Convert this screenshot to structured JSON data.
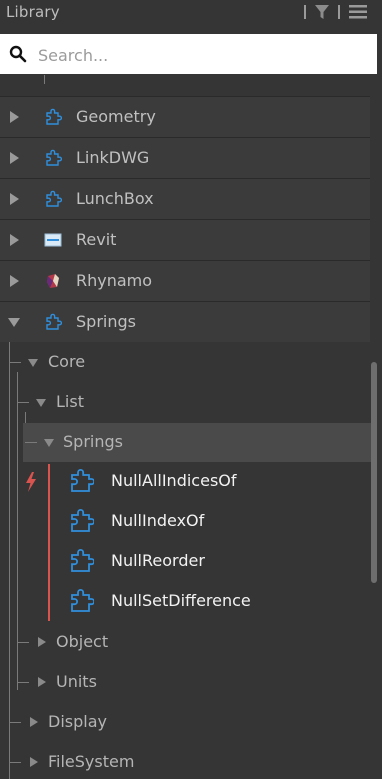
{
  "header": {
    "title": "Library",
    "icons": [
      "filter-icon",
      "list-view-icon"
    ]
  },
  "search": {
    "placeholder": "Search...",
    "value": ""
  },
  "categories": [
    {
      "label": "Geometry",
      "icon": "package-icon",
      "expanded": false
    },
    {
      "label": "LinkDWG",
      "icon": "package-icon",
      "expanded": false
    },
    {
      "label": "LunchBox",
      "icon": "package-icon",
      "expanded": false
    },
    {
      "label": "Revit",
      "icon": "revit-icon",
      "expanded": false
    },
    {
      "label": "Rhynamo",
      "icon": "rhynamo-icon",
      "expanded": false
    },
    {
      "label": "Springs",
      "icon": "package-icon",
      "expanded": true
    }
  ],
  "tree": {
    "core": "Core",
    "list": "List",
    "springs": "Springs",
    "object": "Object",
    "units": "Units",
    "display": "Display",
    "filesystem": "FileSystem"
  },
  "members": [
    {
      "label": "NullAllIndicesOf",
      "icon": "node-icon"
    },
    {
      "label": "NullIndexOf",
      "icon": "node-icon"
    },
    {
      "label": "NullReorder",
      "icon": "node-icon"
    },
    {
      "label": "NullSetDifference",
      "icon": "node-icon"
    }
  ],
  "member_group_icon": "lightning-icon",
  "colors": {
    "panel_bg": "#353535",
    "category_bg": "#3b3b3b",
    "selected_row_bg": "#4a4a4a",
    "accent_red": "#d9534f",
    "node_icon_blue": "#2f8fdc"
  }
}
